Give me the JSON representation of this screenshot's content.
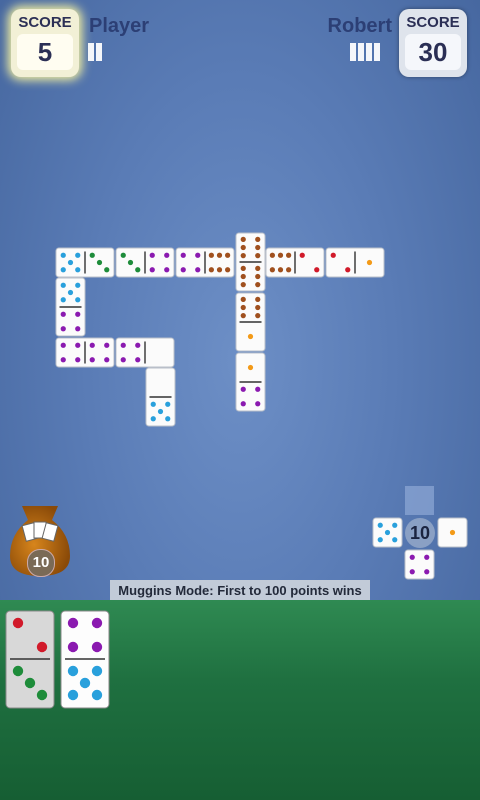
{
  "player": {
    "score_label": "SCORE",
    "score": "5",
    "name": "Player",
    "marks": 2
  },
  "opponent": {
    "score_label": "SCORE",
    "score": "30",
    "name": "Robert",
    "marks": 4
  },
  "boneyard": {
    "count": "10"
  },
  "compass": {
    "count": "10"
  },
  "mode_banner": "Muggins Mode: First to 100 points wins",
  "colors": {
    "pip_1": "#f39a18",
    "pip_2": "#d11a2a",
    "pip_3": "#1e8c3a",
    "pip_4": "#8b1ab0",
    "pip_5": "#29a0dc",
    "pip_6": "#a0501e",
    "pip_4_alt": "#8b1ab0"
  },
  "board_tiles": [
    {
      "a": 5,
      "b": 3,
      "orient": "h"
    },
    {
      "a": 3,
      "b": 4,
      "orient": "h"
    },
    {
      "a": 4,
      "b": 6,
      "orient": "h"
    },
    {
      "a": 6,
      "b": 6,
      "orient": "v"
    },
    {
      "a": 6,
      "b": 2,
      "orient": "h"
    },
    {
      "a": 2,
      "b": 1,
      "orient": "h"
    },
    {
      "a": 5,
      "b": 4,
      "orient": "v"
    },
    {
      "a": 4,
      "b": 4,
      "orient": "h"
    },
    {
      "a": 4,
      "b": 0,
      "orient": "h"
    },
    {
      "a": 0,
      "b": 5,
      "orient": "v"
    },
    {
      "a": 6,
      "b": 1,
      "orient": "v"
    },
    {
      "a": 1,
      "b": 4,
      "orient": "v"
    }
  ],
  "compass_tiles": [
    {
      "a": 5,
      "b": 5,
      "pos": "left"
    },
    {
      "a": 1,
      "b": 1,
      "pos": "right"
    },
    {
      "a": 4,
      "b": 4,
      "pos": "bottom"
    }
  ],
  "hand": [
    {
      "a": 2,
      "b": 3
    },
    {
      "a": 4,
      "b": 5
    }
  ]
}
